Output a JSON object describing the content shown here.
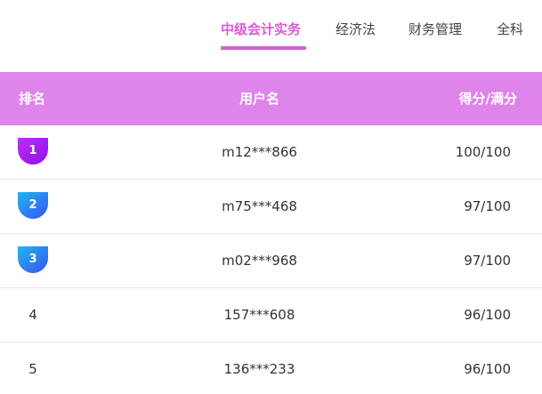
{
  "tabs": [
    {
      "label": "中级会计实务",
      "active": true
    },
    {
      "label": "经济法",
      "active": false
    },
    {
      "label": "财务管理",
      "active": false
    },
    {
      "label": "全科",
      "active": false
    }
  ],
  "table": {
    "headers": {
      "rank": "排名",
      "user": "用户名",
      "score": "得分/满分"
    },
    "header_color": "#df84ea",
    "rows": [
      {
        "rank": "1",
        "user": "m12***866",
        "score": "100/100",
        "badge": "purple"
      },
      {
        "rank": "2",
        "user": "m75***468",
        "score": "97/100",
        "badge": "blue"
      },
      {
        "rank": "3",
        "user": "m02***968",
        "score": "97/100",
        "badge": "blue"
      },
      {
        "rank": "4",
        "user": "157***608",
        "score": "96/100",
        "badge": null
      },
      {
        "rank": "5",
        "user": "136***233",
        "score": "96/100",
        "badge": null
      }
    ]
  },
  "colors": {
    "accent": "#d95cd7",
    "badge_purple": "#a41af2",
    "badge_blue": "#2a8ef0"
  }
}
